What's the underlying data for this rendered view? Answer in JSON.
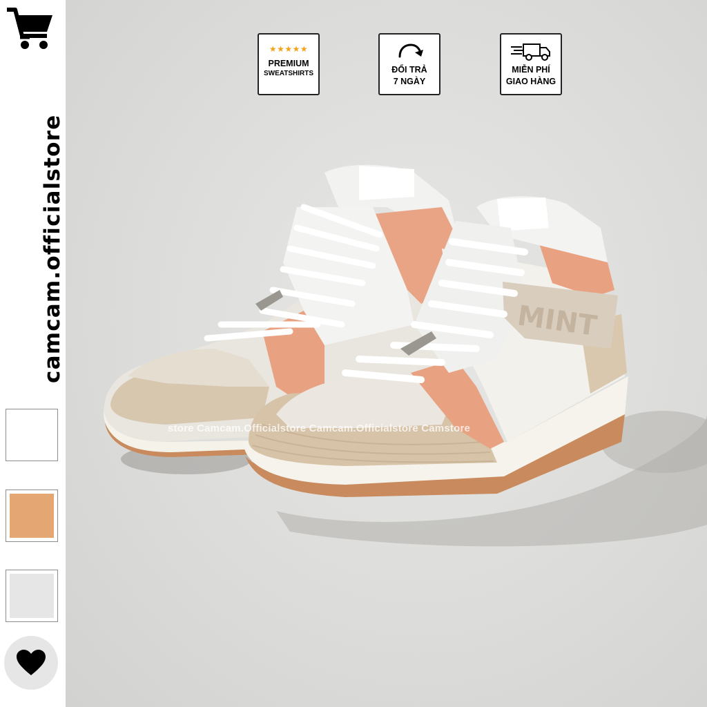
{
  "sidebar": {
    "cart_icon": "shopping-cart-icon",
    "brand": "camcam.officialstore",
    "swatches": [
      {
        "color": "#ffffff"
      },
      {
        "color": "#e4a672"
      },
      {
        "color": "#e6e6e6"
      }
    ],
    "favorite_icon": "heart-icon"
  },
  "badges": [
    {
      "icon": "five-stars-icon",
      "line1": "PREMIUM",
      "line2": "SWEATSHIRTS"
    },
    {
      "icon": "return-arrow-icon",
      "line1": "ĐỔI TRẢ",
      "line2": "7 NGÀY"
    },
    {
      "icon": "delivery-truck-icon",
      "line1": "MIỄN PHÍ",
      "line2": "GIAO HÀNG"
    }
  ],
  "product_image": {
    "watermark": "store Camcam.Officialstore Camcam.Officialstore Camstore",
    "strap_text": "MINT"
  }
}
